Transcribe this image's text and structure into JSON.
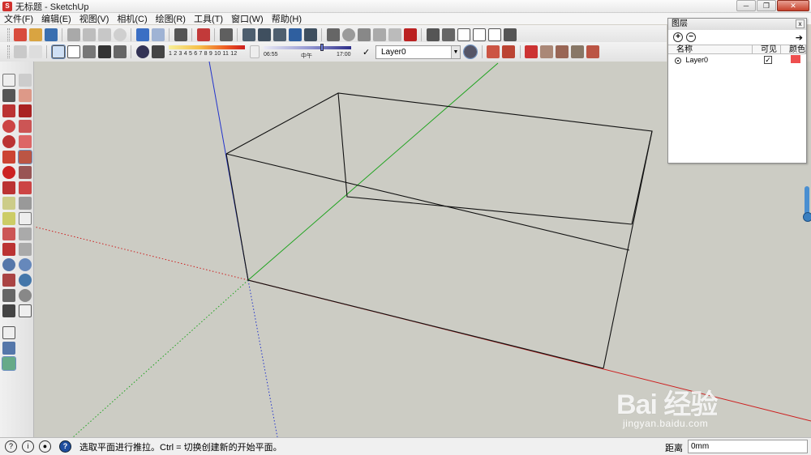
{
  "window": {
    "title": "无标题 - SketchUp",
    "minimize": "─",
    "maximize": "❐",
    "close": "✕"
  },
  "menu": [
    "文件(F)",
    "编辑(E)",
    "视图(V)",
    "相机(C)",
    "绘图(R)",
    "工具(T)",
    "窗口(W)",
    "帮助(H)"
  ],
  "shadow_settings": {
    "month_ticks": "1 2 3 4 5 6 7 8 9 10 11 12",
    "time_start": "06:55",
    "time_mid": "中午",
    "time_end": "17:00"
  },
  "layer_toolbar": {
    "current_layer": "Layer0",
    "check": "✓"
  },
  "layer_panel": {
    "title": "图层",
    "add": "+",
    "remove": "−",
    "export_icon": "➔",
    "columns": {
      "name": "名称",
      "visible": "可见",
      "color": "颜色"
    },
    "rows": [
      {
        "name": "Layer0",
        "visible": "✓",
        "color": "#ee4f4f"
      }
    ]
  },
  "viewport": {
    "background": "#ccccc4",
    "axis_red": "#cc1f1f",
    "axis_green": "#1ea31e",
    "axis_blue": "#2233cc",
    "edge_color": "#111111"
  },
  "status": {
    "hint": "选取平面进行推拉。Ctrl = 切换创建新的开始平面。",
    "measure_label": "距离",
    "measure_value": "0mm",
    "icon_geo": "?",
    "icon_info": "i",
    "icon_user": "●",
    "icon_help": "?"
  },
  "watermark": {
    "brand": "Bai 经验",
    "url": "jingyan.baidu.com"
  }
}
